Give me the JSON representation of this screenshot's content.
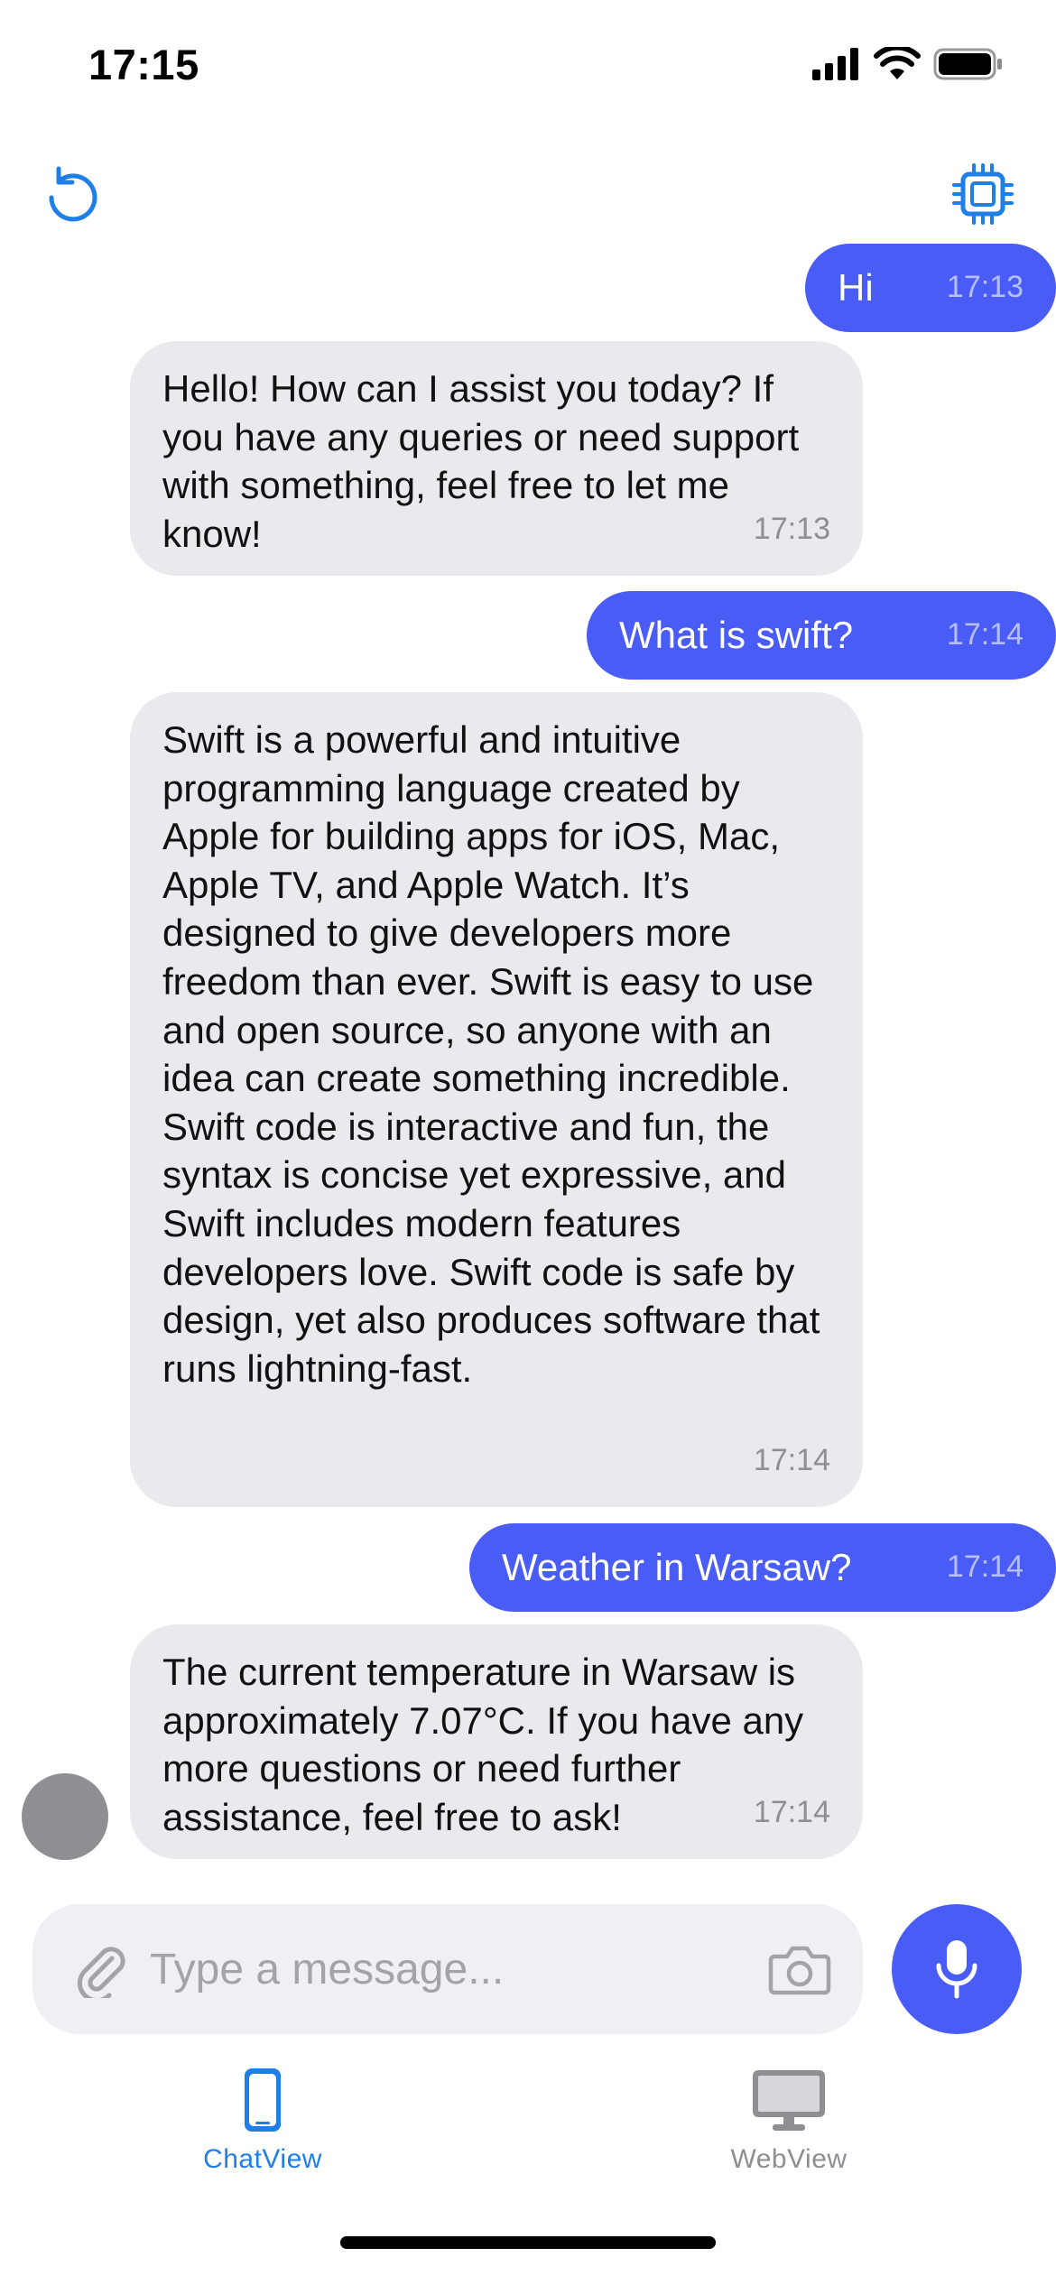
{
  "status_bar": {
    "time": "17:15"
  },
  "nav": {
    "left_icon": "refresh-icon",
    "right_icon": "chip-icon"
  },
  "colors": {
    "accent": "#4a5cf6",
    "tint": "#1f7fe8",
    "incoming_bubble": "#e9e9ee",
    "muted": "#8e8e93"
  },
  "messages": [
    {
      "role": "user",
      "text": "Hi",
      "time": "17:13"
    },
    {
      "role": "assistant",
      "text": "Hello! How can I assist you today? If you have any queries or need support with something, feel free to let me know!",
      "time": "17:13"
    },
    {
      "role": "user",
      "text": "What is swift?",
      "time": "17:14"
    },
    {
      "role": "assistant",
      "text": "Swift is a powerful and intuitive programming language created by Apple for building apps for iOS, Mac, Apple TV, and Apple Watch. It’s designed to give developers more freedom than ever. Swift is easy to use and open source, so anyone with an idea can create something incredible. Swift code is interactive and fun, the syntax is concise yet expressive, and Swift includes modern features developers love. Swift code is safe by design, yet also produces software that runs lightning-fast.",
      "time": "17:14"
    },
    {
      "role": "user",
      "text": "Weather in Warsaw?",
      "time": "17:14"
    },
    {
      "role": "assistant",
      "text": "The current temperature in Warsaw is approximately 7.07°C. If you have any more questions or need further assistance, feel free to ask!",
      "time": "17:14"
    }
  ],
  "composer": {
    "placeholder": "Type a message...",
    "value": ""
  },
  "tabs": [
    {
      "label": "ChatView",
      "icon": "iphone-icon",
      "selected": true
    },
    {
      "label": "WebView",
      "icon": "display-icon",
      "selected": false
    }
  ]
}
